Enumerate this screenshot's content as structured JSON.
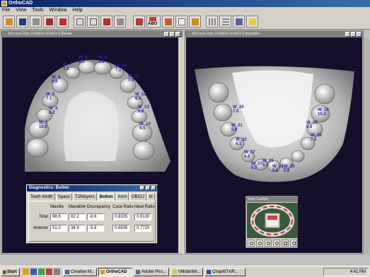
{
  "app": {
    "title": "OrthoCAD"
  },
  "menu": [
    "File",
    "View",
    "Tools",
    "Window",
    "Help"
  ],
  "toolbar_icons": [
    "open-icon",
    "save-icon",
    "print-icon",
    "export-icon",
    "cube-icon",
    "view-front-icon",
    "view-top-icon",
    "view-side-icon",
    "rotate-icon",
    "model-icon",
    "measure-icon",
    "abo-icon",
    "occlusion-icon",
    "tooth-icon",
    "edit-icon",
    "grid-icon",
    "table-icon",
    "chart-icon",
    "help-icon"
  ],
  "toolbar_abo_label": "ABO",
  "windows": {
    "left": {
      "title": "Burrows,Dale 2039620 4/19/04 0 Maxilla"
    },
    "right": {
      "title": "Burrows,Dale 2039620 4/19/04 0 Mandible"
    }
  },
  "maxilla_labels": [
    {
      "id": "W_8",
      "w": "W_8",
      "v": "8.9"
    },
    {
      "id": "W_9",
      "w": "W_9",
      "v": "8.8"
    },
    {
      "id": "W_7",
      "w": "W_7",
      "v": "7.1"
    },
    {
      "id": "W_10",
      "w": "W_10",
      "v": "7.1"
    },
    {
      "id": "W_6",
      "w": "W_6",
      "v": "8.9"
    },
    {
      "id": "W_11",
      "w": "W_11",
      "v": "7.9"
    },
    {
      "id": "W_5",
      "w": "W_5",
      "v": "7.1"
    },
    {
      "id": "W_12",
      "w": "W_12",
      "v": "6.4"
    },
    {
      "id": "W_4",
      "w": "W_4",
      "v": "6.2"
    },
    {
      "id": "W_13",
      "w": "W_13",
      "v": "6.8"
    },
    {
      "id": "W_3",
      "w": "W_3",
      "v": "10.6"
    },
    {
      "id": "W_14",
      "w": "W_14",
      "v": "9.5"
    }
  ],
  "mandible_labels": [
    {
      "id": "W_20",
      "w": "W_20",
      "v": "7.0"
    },
    {
      "id": "W_19",
      "w": "W_19",
      "v": "10.3"
    },
    {
      "id": "W_21",
      "w": "W_21",
      "v": "5.8"
    },
    {
      "id": "W_28",
      "w": "W_28",
      "v": "6.6"
    },
    {
      "id": "W_29",
      "w": "W_29",
      "v": "7.8"
    },
    {
      "id": "W_22",
      "w": "W_22",
      "v": "6.1"
    },
    {
      "id": "W_27",
      "w": "W_27",
      "v": "6.6"
    },
    {
      "id": "W_23",
      "w": "W_23",
      "v": "5.3"
    },
    {
      "id": "W_26",
      "w": "W_26",
      "v": "5.3"
    },
    {
      "id": "W_24",
      "w": "W_24",
      "v": "5.8"
    },
    {
      "id": "W_25",
      "w": "W_25",
      "v": "5.6"
    }
  ],
  "bolton_dialog": {
    "title": "Diagnostics: Bolton",
    "tabs": [
      "Teeth Width",
      "Space",
      "TJ/Moyers",
      "Bolton",
      "Arch",
      "OB/OJ",
      "M"
    ],
    "active_tab": "Bolton",
    "headers": [
      "Maxilla",
      "Mandible",
      "Discrepancy",
      "Case Ratio",
      "Ideal Ratio"
    ],
    "rows": [
      {
        "label": "Total",
        "values": [
          "98.6",
          "82.2",
          "-8.6",
          "0.8335",
          "0.9130"
        ]
      },
      {
        "label": "Anterior",
        "values": [
          "51.0",
          "34.9",
          "-5.8",
          "0.6835",
          "0.7720"
        ]
      }
    ]
  },
  "view_control": {
    "title": "View Control"
  },
  "taskbar": {
    "start": "Start",
    "tasks": [
      {
        "label": "Creative M..."
      },
      {
        "label": "OrthoCAD"
      },
      {
        "label": "Adobe Pho..."
      },
      {
        "label": "\\\\Molar\\fel..."
      },
      {
        "label": "Chapt6TxtR..."
      }
    ],
    "active_task": "OrthoCAD",
    "clock": "4:41 PM"
  }
}
